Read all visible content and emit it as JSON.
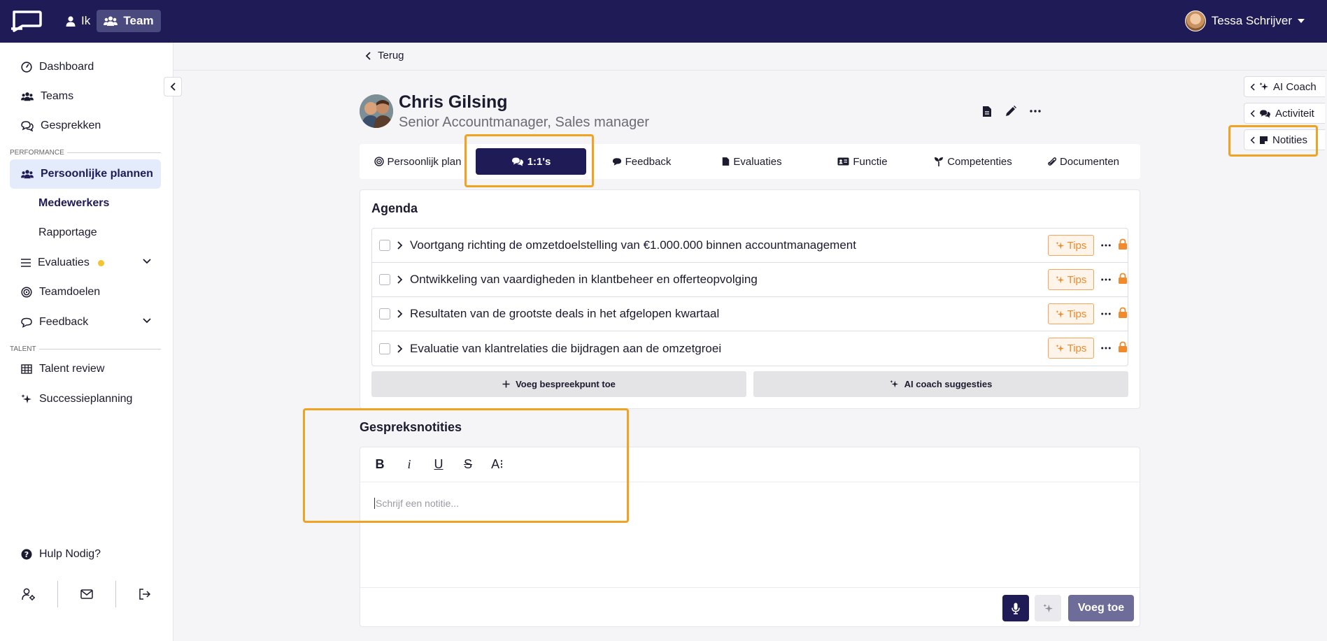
{
  "topbar": {
    "nav_ik": "Ik",
    "nav_team": "Team",
    "user_name": "Tessa Schrijver"
  },
  "sidebar": {
    "dashboard": "Dashboard",
    "teams": "Teams",
    "gesprekken": "Gesprekken",
    "section_performance": "PERFORMANCE",
    "persoonlijke": "Persoonlijke plannen",
    "medewerkers": "Medewerkers",
    "rapportage": "Rapportage",
    "evaluaties": "Evaluaties",
    "teamdoelen": "Teamdoelen",
    "feedback": "Feedback",
    "section_talent": "TALENT",
    "talent_review": "Talent review",
    "successieplanning": "Successieplanning",
    "hulp": "Hulp Nodig?"
  },
  "main": {
    "back": "Terug",
    "name": "Chris Gilsing",
    "role": "Senior Accountmanager, Sales manager",
    "tabs": [
      {
        "label": "Persoonlijk plan"
      },
      {
        "label": "1:1's"
      },
      {
        "label": "Feedback"
      },
      {
        "label": "Evaluaties"
      },
      {
        "label": "Functie"
      },
      {
        "label": "Competenties"
      },
      {
        "label": "Documenten"
      }
    ],
    "agenda_title": "Agenda",
    "agenda_items": [
      {
        "text": "Voortgang richting de omzetdoelstelling van €1.000.000 binnen accountmanagement"
      },
      {
        "text": "Ontwikkeling van vaardigheden in klantbeheer en offerteopvolging"
      },
      {
        "text": "Resultaten van de grootste deals in het afgelopen kwartaal"
      },
      {
        "text": "Evaluatie van klantrelaties die bijdragen aan de omzetgroei"
      }
    ],
    "tips_label": "Tips",
    "add_point": "Voeg bespreekpunt toe",
    "ai_suggestions": "AI coach suggesties",
    "notes_title": "Gespreksnotities",
    "toolbar": {
      "bold": "B",
      "italic": "i",
      "underline": "U",
      "strike": "S",
      "text_size": "A⁝"
    },
    "notes_placeholder": "Schrijf een notitie...",
    "add_button": "Voeg toe"
  },
  "rail": {
    "ai_coach": "AI Coach",
    "activiteit": "Activiteit",
    "notities": "Notities"
  },
  "colors": {
    "brand": "#1e1b57",
    "highlight": "#f0a323",
    "tips": "#f08a2a"
  }
}
